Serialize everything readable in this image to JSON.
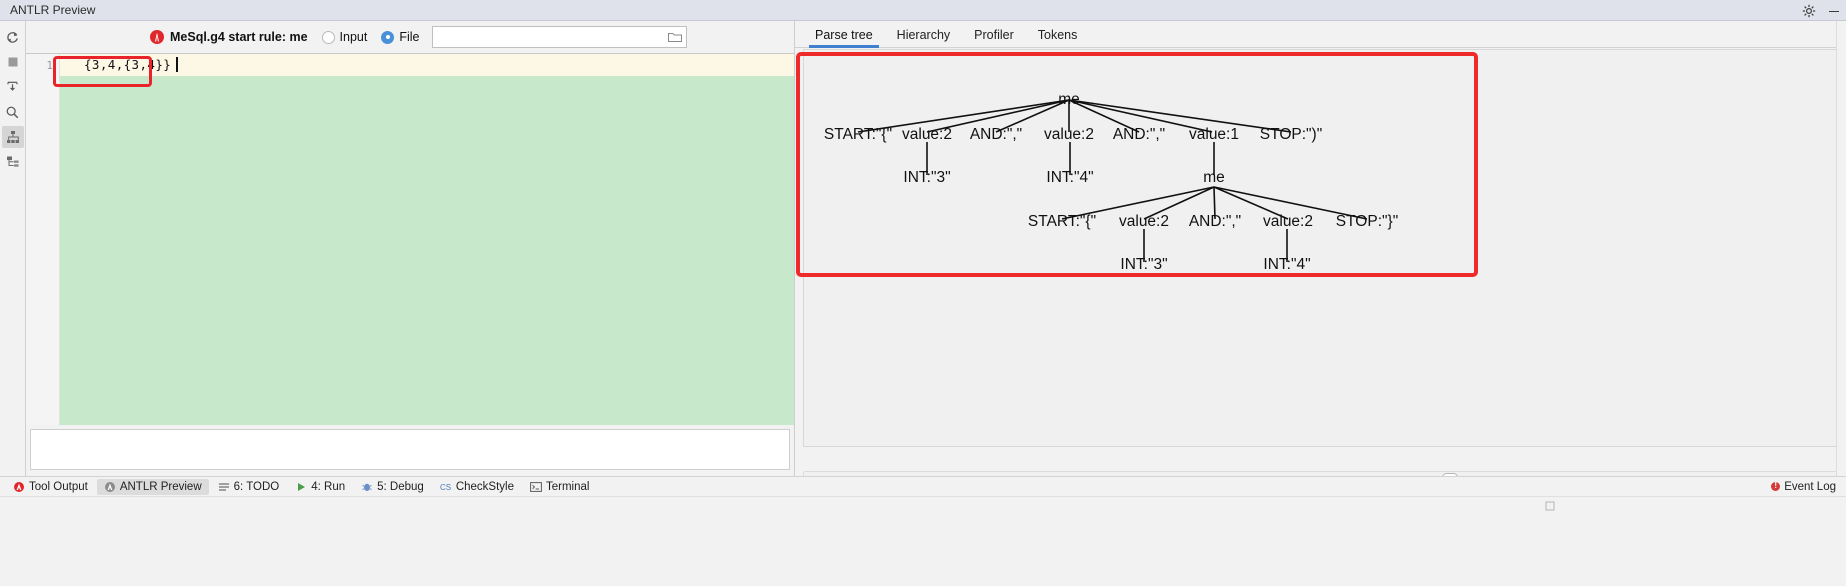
{
  "window": {
    "title": "ANTLR Preview",
    "settings_icon": "gear-icon",
    "minimize_icon": "minimize-icon"
  },
  "rail": {
    "items": [
      {
        "name": "refresh-icon",
        "label": "Refresh",
        "selected": false
      },
      {
        "name": "stop-icon",
        "label": "Stop",
        "selected": false
      },
      {
        "name": "export-icon",
        "label": "Export",
        "selected": false
      },
      {
        "name": "search-icon",
        "label": "Find",
        "selected": false
      },
      {
        "name": "hierarchy-icon",
        "label": "Hierarchy",
        "selected": true
      },
      {
        "name": "tree-structure-icon",
        "label": "Tree Structure",
        "selected": false
      }
    ]
  },
  "toolbar": {
    "logo_icon": "antlr-logo-icon",
    "rule_label": "MeSql.g4 start rule: me",
    "input_radio_label": "Input",
    "input_radio_selected": false,
    "file_radio_label": "File",
    "file_radio_selected": true,
    "file_path_value": "",
    "file_path_placeholder": "",
    "browse_icon": "folder-icon"
  },
  "editor": {
    "line_number": "1",
    "content": "{3,4,{3,4}}",
    "highlight_color": "#e8232a"
  },
  "tabs": {
    "items": [
      {
        "label": "Parse tree",
        "active": true
      },
      {
        "label": "Hierarchy",
        "active": false
      },
      {
        "label": "Profiler",
        "active": false
      },
      {
        "label": "Tokens",
        "active": false
      }
    ]
  },
  "parse_tree": {
    "nodes": {
      "root": "me",
      "l1_start": "START:\"{\"",
      "l1_value1": "value:2",
      "l1_and1": "AND:\",\"",
      "l1_value2": "value:2",
      "l1_and2": "AND:\",\"",
      "l1_value3": "value:1",
      "l1_stop": "STOP:\")\"",
      "l2_int1": "INT:\"3\"",
      "l2_int2": "INT:\"4\"",
      "l2_me": "me",
      "l3_start": "START:\"{\"",
      "l3_value1": "value:2",
      "l3_and": "AND:\",\"",
      "l3_value2": "value:2",
      "l3_stop": "STOP:\"}\"",
      "l4_int1": "INT:\"3\"",
      "l4_int2": "INT:\"4\""
    },
    "annotation_color": "#ee2a2a"
  },
  "bottom_bar": {
    "items": [
      {
        "label": "Tool Output",
        "icon": "tool-output-icon",
        "active": false
      },
      {
        "label": "ANTLR Preview",
        "icon": "antlr-icon",
        "active": true
      },
      {
        "label": "6: TODO",
        "icon": "todo-icon",
        "active": false
      },
      {
        "label": "4: Run",
        "icon": "run-icon",
        "active": false
      },
      {
        "label": "5: Debug",
        "icon": "debug-icon",
        "active": false
      },
      {
        "label": "CheckStyle",
        "icon": "checkstyle-icon",
        "active": false
      },
      {
        "label": "Terminal",
        "icon": "terminal-icon",
        "active": false
      }
    ],
    "event_log": {
      "label": "Event Log",
      "icon": "error-icon"
    }
  }
}
